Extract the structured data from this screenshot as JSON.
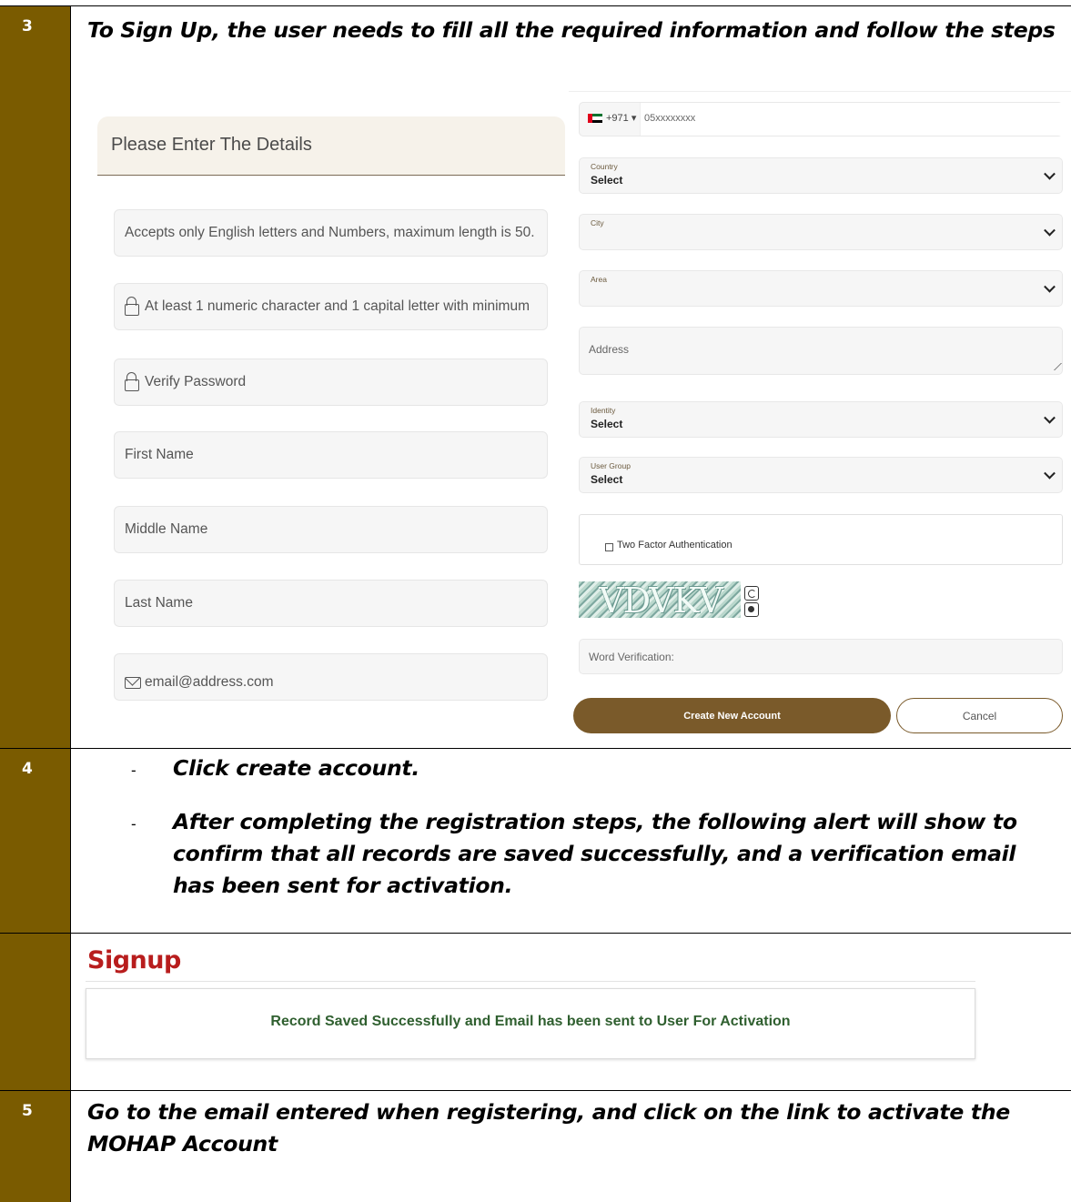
{
  "steps": [
    {
      "number": "3",
      "heading": "To Sign Up, the user needs to fill all the required information and follow the steps"
    },
    {
      "number": "4",
      "bullets": [
        {
          "marker": "-",
          "text": "Click create account."
        },
        {
          "marker": "-",
          "text": "After completing the registration steps, the following alert will show to confirm that all records are saved successfully, and a verification email has been sent for activation."
        }
      ]
    },
    {
      "number": "",
      "signup_title": "Signup",
      "alert_message": "Record Saved Successfully and Email has been sent to User For Activation"
    },
    {
      "number": "5",
      "heading": "Go to the email entered when registering, and click on the link to activate the MOHAP Account"
    }
  ],
  "form": {
    "title": "Please Enter The Details",
    "left_fields": [
      {
        "placeholder": "Accepts only English letters and Numbers, maximum length is 50.",
        "icon": "none"
      },
      {
        "placeholder": "At least 1 numeric character and 1 capital letter with minimum",
        "icon": "lock-icon"
      },
      {
        "placeholder": "Verify Password",
        "icon": "lock-icon"
      },
      {
        "placeholder": "First Name",
        "icon": "none"
      },
      {
        "placeholder": "Middle Name",
        "icon": "none"
      },
      {
        "placeholder": "Last Name",
        "icon": "none"
      },
      {
        "placeholder": "email@address.com",
        "icon": "mail-icon"
      }
    ],
    "phone": {
      "country_code": "+971",
      "code_arrow": "▾",
      "placeholder": "05xxxxxxxx"
    },
    "country": {
      "label": "Country",
      "value": "Select"
    },
    "city": {
      "label": "City",
      "value": ""
    },
    "area": {
      "label": "Area",
      "value": ""
    },
    "address": {
      "placeholder": "Address"
    },
    "identity": {
      "label": "Identity",
      "value": "Select"
    },
    "user_group": {
      "label": "User Group",
      "value": "Select"
    },
    "two_factor": {
      "label": "Two Factor Authentication",
      "checked": false
    },
    "captcha": {
      "text": "VDVKV"
    },
    "word_verification": {
      "placeholder": "Word Verification:"
    },
    "create_button": "Create New Account",
    "cancel_button": "Cancel"
  },
  "colors": {
    "number_column": "#7a5b00",
    "button_brown": "#7a5a2a",
    "signup_red": "#b81d1d",
    "alert_green": "#2f5f2f"
  }
}
